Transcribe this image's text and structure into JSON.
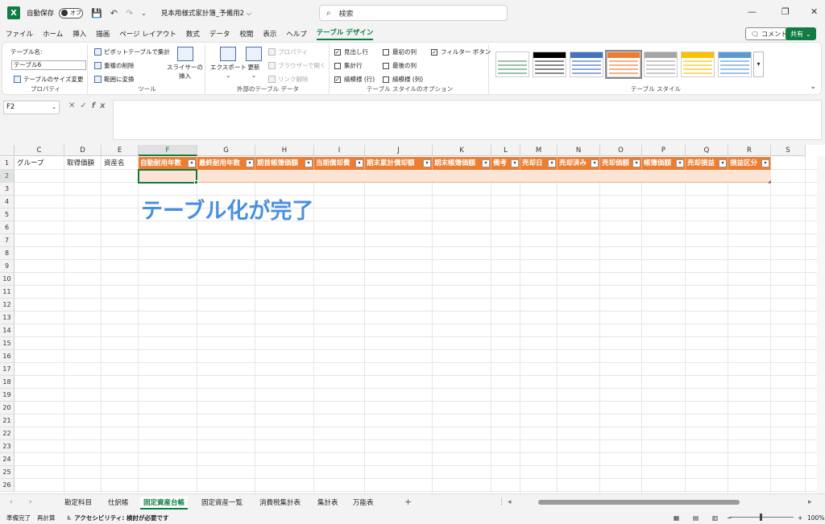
{
  "titlebar": {
    "autosave_label": "自動保存",
    "toggle_label": "オフ",
    "doc_title": "見本用様式家計簿_予備用2 ⌵",
    "search_placeholder": "検索"
  },
  "menu": {
    "tabs": [
      "ファイル",
      "ホーム",
      "挿入",
      "描画",
      "ページ レイアウト",
      "数式",
      "データ",
      "校閲",
      "表示",
      "ヘルプ",
      "テーブル デザイン"
    ],
    "comment": "コメント",
    "share": "共有"
  },
  "ribbon": {
    "properties": {
      "name_label": "テーブル名:",
      "name_value": "テーブル6",
      "resize": "テーブルのサイズ変更",
      "group": "プロパティ"
    },
    "tools": {
      "pivot": "ピボットテーブルで集計",
      "dedupe": "重複の削除",
      "convert": "範囲に変換",
      "slicer_1": "スライサーの",
      "slicer_2": "挿入",
      "group": "ツール"
    },
    "external": {
      "export": "エクスポート",
      "refresh": "更新",
      "properties": "プロパティ",
      "open_browser": "ブラウザーで開く",
      "unlink": "リンク解除",
      "group": "外部のテーブル データ"
    },
    "style_options": {
      "header_row": "見出し行",
      "total_row": "集計行",
      "banded_rows": "縞模様 (行)",
      "first_column": "最初の列",
      "last_column": "最後の列",
      "banded_columns": "縞模様 (列)",
      "filter_button": "フィルター ボタン",
      "group": "テーブル スタイルのオプション"
    },
    "styles": {
      "group": "テーブル スタイル",
      "swatches": [
        {
          "header": "#ffffff",
          "line": "#9bc2a8"
        },
        {
          "header": "#000000",
          "line": "#888888"
        },
        {
          "header": "#4472c4",
          "line": "#8ea9db"
        },
        {
          "header": "#ed7d31",
          "line": "#f4b183"
        },
        {
          "header": "#a5a5a5",
          "line": "#c9c9c9"
        },
        {
          "header": "#ffc000",
          "line": "#ffd966"
        },
        {
          "header": "#5b9bd5",
          "line": "#9dc3e6"
        }
      ]
    }
  },
  "formula": {
    "namebox": "F2",
    "fx": "fx"
  },
  "grid": {
    "columns": [
      "C",
      "D",
      "E",
      "F",
      "G",
      "H",
      "I",
      "J",
      "K",
      "L",
      "M",
      "N",
      "O",
      "P",
      "Q",
      "R",
      "S"
    ],
    "rows": [
      "1",
      "2",
      "3",
      "4",
      "5",
      "6",
      "7",
      "8",
      "9",
      "10",
      "11",
      "12",
      "13",
      "14",
      "15",
      "16",
      "17",
      "18",
      "19",
      "20",
      "21",
      "22",
      "23",
      "24",
      "25",
      "26"
    ],
    "plain_headers": [
      "グループ",
      "取得価額",
      "資産名"
    ],
    "table_headers": [
      "自動耐用年数",
      "最終耐用年数",
      "期首帳簿価額",
      "当期償却費",
      "期末累計償却額",
      "期末帳簿価額",
      "備考",
      "売却日",
      "売却済み",
      "売却価額",
      "帳簿価額",
      "売却損益",
      "損益区分"
    ],
    "overlay": "テーブル化が完了"
  },
  "sheets": {
    "tabs": [
      "勘定科目",
      "仕訳帳",
      "固定資産台帳",
      "固定資産一覧",
      "消費税集計表",
      "集計表",
      "万能表"
    ],
    "active_index": 2
  },
  "status": {
    "ready": "準備完了",
    "recalc": "再計算",
    "accessibility": "アクセシビリティ: 検討が必要です",
    "zoom": "100%"
  },
  "colors": {
    "accent": "#107c41",
    "table_header": "#ed7d31",
    "table_row": "#fce4d6",
    "overlay_text": "#4a8fe0"
  }
}
